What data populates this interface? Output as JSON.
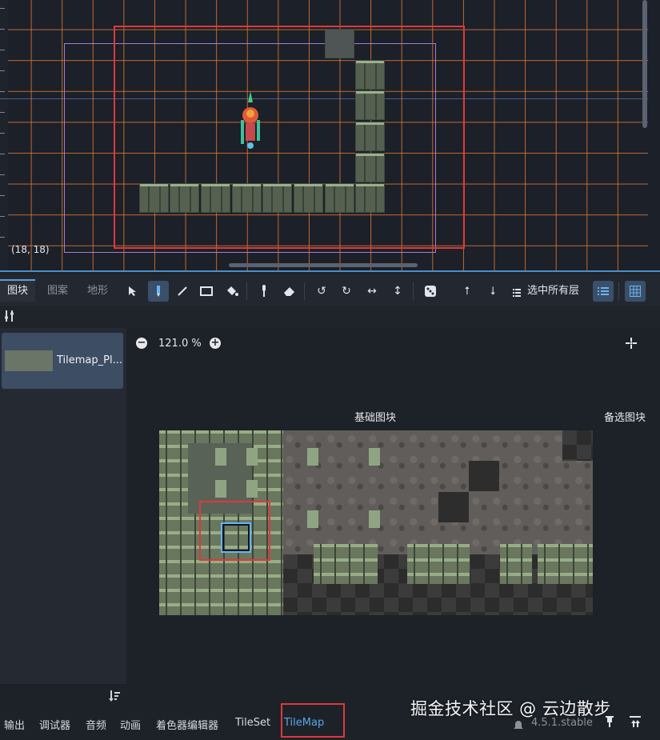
{
  "viewport": {
    "coordinate_readout": "(18, 18)"
  },
  "tile_toolbar": {
    "tabs": [
      "图块",
      "图案",
      "地形"
    ],
    "active_tab": "图块",
    "tools": [
      "select-arrow-icon",
      "paint-pencil-icon",
      "line-icon",
      "rect-icon",
      "bucket-fill-icon",
      "picker-icon",
      "eraser-icon",
      "rotate-left-icon",
      "rotate-right-icon",
      "flip-h-icon",
      "flip-v-icon",
      "random-dice-icon",
      "layer-up-icon",
      "layer-down-icon"
    ],
    "layers_label": "选中所有层"
  },
  "source_list": {
    "items": [
      "Tilemap_Pl..."
    ]
  },
  "atlas": {
    "zoom": "121.0 %",
    "base_tiles_label": "基础图块",
    "alt_tiles_label": "备选图块"
  },
  "bottom_tabs": [
    "输出",
    "调试器",
    "音频",
    "动画",
    "着色器编辑器",
    "TileSet",
    "TileMap"
  ],
  "active_bottom_tab": "TileMap",
  "version": "4.5.1.stable",
  "watermark": "掘金技术社区 @ 云边散步",
  "colors": {
    "accent": "#5aa6ea",
    "highlight_red": "#e0383b",
    "grid_orange": "#e37630"
  }
}
